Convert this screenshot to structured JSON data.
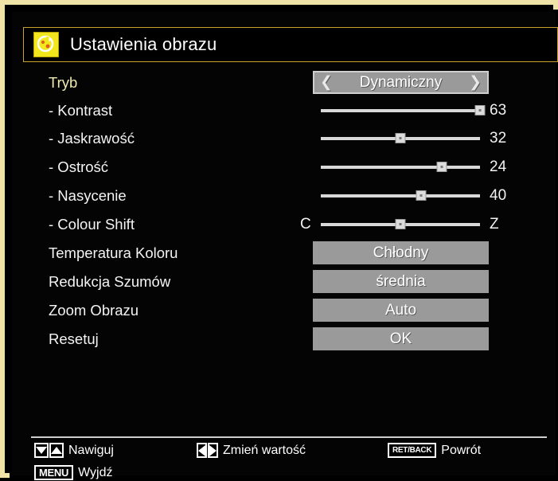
{
  "window": {
    "title": "Ustawienia obrazu",
    "icon": "picture-settings-icon",
    "frame_color": "#efe3a8",
    "accent_color": "#c9a227",
    "selected_row_color": "#efe9b4"
  },
  "menu": {
    "rows": [
      {
        "label": "Tryb",
        "control": "spinner",
        "value": "Dynamiczny",
        "left_arrow": "❮",
        "right_arrow": "❯",
        "selected": true
      },
      {
        "label": "- Kontrast",
        "control": "slider",
        "value": "63",
        "percent": 100,
        "selected": false
      },
      {
        "label": "- Jaskrawość",
        "control": "slider",
        "value": "32",
        "percent": 50,
        "selected": false
      },
      {
        "label": "- Ostrość",
        "control": "slider",
        "value": "24",
        "percent": 76,
        "selected": false
      },
      {
        "label": "- Nasycenie",
        "control": "slider",
        "value": "40",
        "percent": 63,
        "selected": false
      },
      {
        "label": "- Colour Shift",
        "control": "slider",
        "value": "Z",
        "left_edge_label": "C",
        "percent": 50,
        "selected": false
      },
      {
        "label": "Temperatura Koloru",
        "control": "valuebox",
        "value": "Chłodny",
        "selected": false
      },
      {
        "label": "Redukcja Szumów",
        "control": "valuebox",
        "value": "średnia",
        "selected": false
      },
      {
        "label": "Zoom Obrazu",
        "control": "valuebox",
        "value": "Auto",
        "selected": false
      },
      {
        "label": "Resetuj",
        "control": "valuebox",
        "value": "OK",
        "selected": false
      }
    ]
  },
  "footer": {
    "hints": [
      {
        "keys": [
          "down-arrow",
          "up-arrow"
        ],
        "label": "Nawiguj"
      },
      {
        "keys": [
          "left-arrow",
          "right-arrow"
        ],
        "label": "Zmień wartość"
      },
      {
        "keys": [
          "RET/BACK"
        ],
        "label": "Powrót"
      },
      {
        "keys": [
          "MENU"
        ],
        "label": "Wyjdź"
      }
    ]
  }
}
